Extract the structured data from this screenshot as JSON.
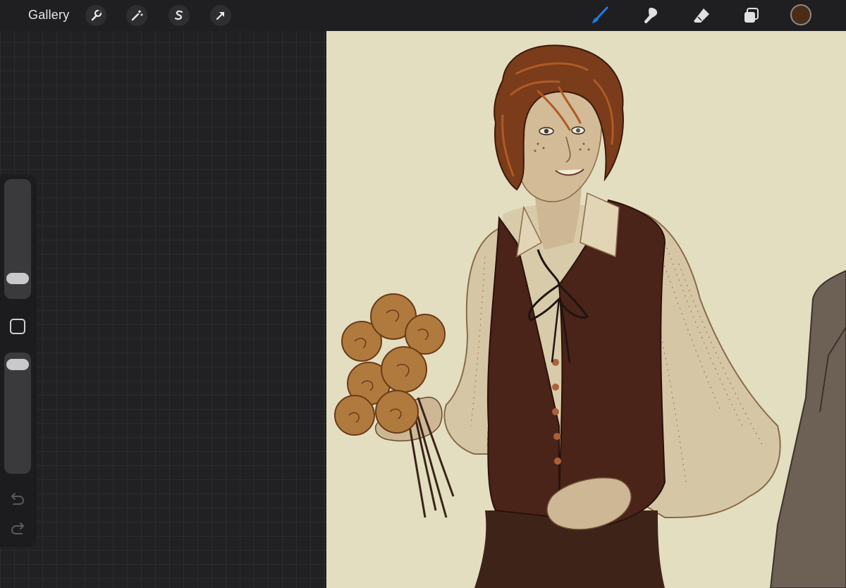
{
  "toolbar": {
    "gallery_label": "Gallery",
    "left_tools": [
      {
        "icon": "wrench-icon",
        "name": "actions"
      },
      {
        "icon": "magic-wand-icon",
        "name": "adjustments"
      },
      {
        "icon": "selection-s-icon",
        "name": "selection"
      },
      {
        "icon": "arrow-cursor-icon",
        "name": "transform"
      }
    ],
    "right_tools": [
      {
        "icon": "brush-icon",
        "name": "paint",
        "active": true
      },
      {
        "icon": "smudge-icon",
        "name": "smudge"
      },
      {
        "icon": "eraser-icon",
        "name": "eraser"
      },
      {
        "icon": "layers-icon",
        "name": "layers"
      }
    ],
    "current_color": "#4a2c17",
    "active_tool_color": "#1e7bf0"
  },
  "sidebar": {
    "brush_size_level": 0.12,
    "opacity_level": 0.96
  },
  "canvas": {
    "background_color": "#e3dec0",
    "artwork": "illustration-of-man-holding-roses"
  }
}
